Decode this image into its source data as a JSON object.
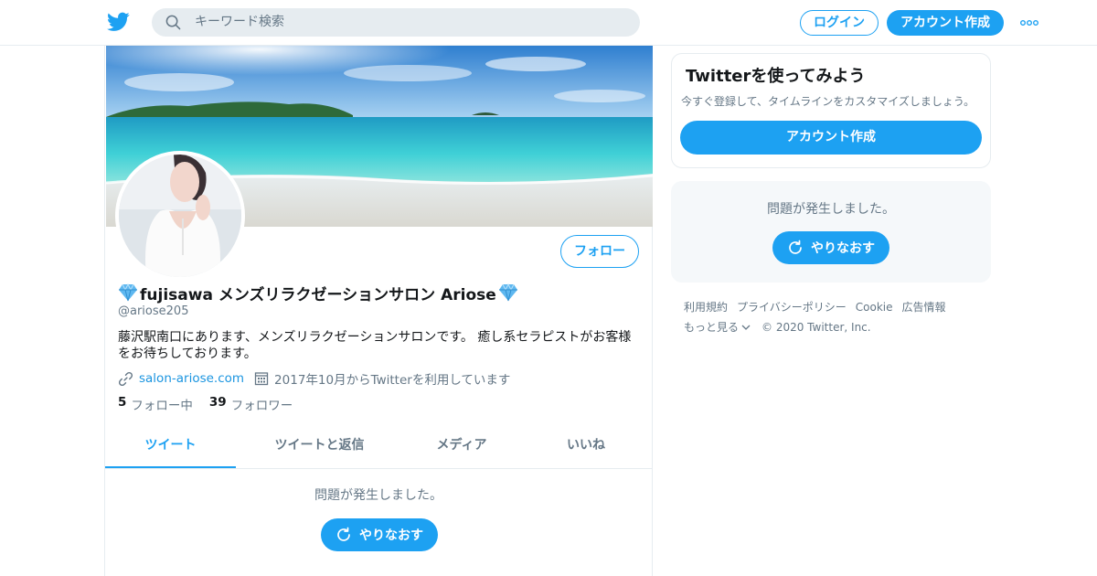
{
  "header": {
    "search_placeholder": "キーワード検索",
    "login_label": "ログイン",
    "signup_label": "アカウント作成"
  },
  "profile": {
    "name": "fujisawa メンズリラクゼーションサロン Ariose",
    "handle": "@ariose205",
    "bio": "藤沢駅南口にあります、メンズリラクゼーションサロンです。 癒し系セラピストがお客様をお待ちしております。",
    "website": "salon-ariose.com",
    "joined": "2017年10月からTwitterを利用しています",
    "following_count": "5",
    "following_label": "フォロー中",
    "followers_count": "39",
    "followers_label": "フォロワー",
    "follow_button": "フォロー"
  },
  "tabs": [
    {
      "label": "ツイート",
      "active": true
    },
    {
      "label": "ツイートと返信",
      "active": false
    },
    {
      "label": "メディア",
      "active": false
    },
    {
      "label": "いいね",
      "active": false
    }
  ],
  "timeline": {
    "error_text": "問題が発生しました。",
    "retry_label": "やりなおす"
  },
  "sidebar": {
    "signup_card": {
      "title": "Twitterを使ってみよう",
      "subtitle": "今すぐ登録して、タイムラインをカスタマイズしましょう。",
      "button": "アカウント作成"
    },
    "error_card": {
      "error_text": "問題が発生しました。",
      "retry_label": "やりなおす"
    },
    "footer": {
      "links": [
        "利用規約",
        "プライバシーポリシー",
        "Cookie",
        "広告情報"
      ],
      "more": "もっと見る",
      "copyright": "© 2020 Twitter, Inc."
    }
  },
  "colors": {
    "brand": "#1da1f2",
    "link": "#1b95e0",
    "secondary_text": "#657786",
    "border": "#e6ecf0"
  }
}
